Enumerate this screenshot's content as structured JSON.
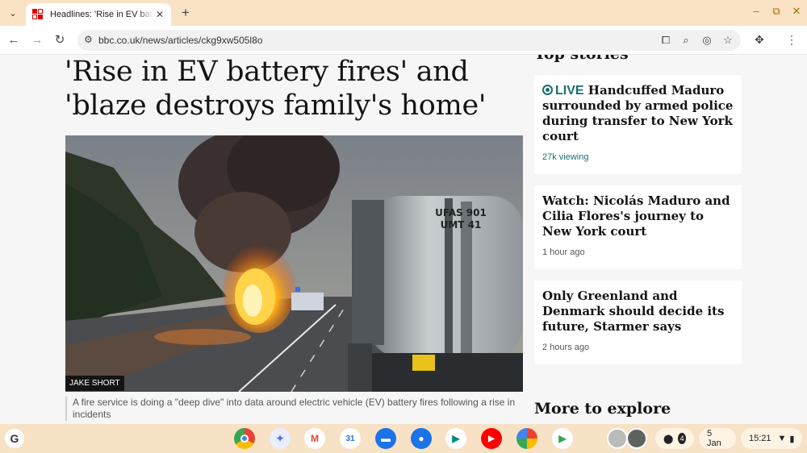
{
  "browser": {
    "tab_title": "Headlines: 'Rise in EV battery fi",
    "url": "bbc.co.uk/news/articles/ckg9xw505l8o"
  },
  "article": {
    "headline": "'Rise in EV battery fires' and 'blaze destroys family's home'",
    "image_credit": "JAKE SHORT",
    "image_text_tanker": "UFAS 901\nUMT 41",
    "caption": "A fire service is doing a \"deep dive\" into data around electric vehicle (EV) battery fires following a rise in incidents"
  },
  "sidebar": {
    "section_title": "Top stories",
    "stories": [
      {
        "live_label": "LIVE",
        "title": "Handcuffed Maduro surrounded by armed police during transfer to New York court",
        "meta": "27k viewing"
      },
      {
        "title": "Watch: Nicolás Maduro and Cilia Flores's journey to New York court",
        "meta": "1 hour ago"
      },
      {
        "title": "Only Greenland and Denmark should decide its future, Starmer says",
        "meta": "2 hours ago"
      }
    ],
    "more_title": "More to explore"
  },
  "shelf": {
    "launcher": "G",
    "notifications_count": "4",
    "date": "5 Jan",
    "time": "15:21"
  },
  "colors": {
    "bbc_live": "#1b6e74",
    "tabstrip": "#f9e3c4",
    "shelf": "#f7e2c6"
  }
}
